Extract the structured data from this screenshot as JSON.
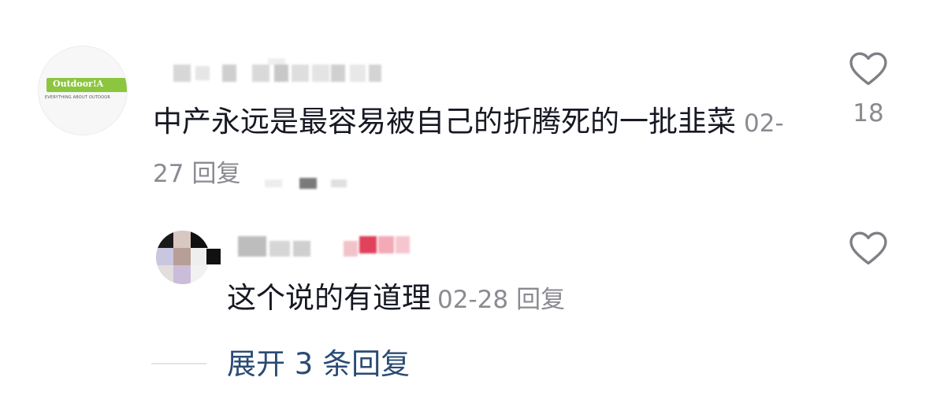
{
  "comment": {
    "avatar": {
      "brand": "Outdoor!A",
      "tagline": "EVERYTHING ABOUT OUTDOOR",
      "accent": "#8cc63f"
    },
    "text": "中产永远是最容易被自己的折腾死的一批韭菜",
    "date": "02-27",
    "reply_label": "回复",
    "likes": "18",
    "like_icon": "heart-outline-icon"
  },
  "reply": {
    "text": "这个说的有道理",
    "date": "02-28",
    "reply_label": "回复",
    "like_icon": "heart-outline-icon"
  },
  "expand": {
    "label": "展开 3 条回复",
    "color": "#2a4b74"
  },
  "colors": {
    "text": "#161823",
    "meta": "#8a8b91"
  }
}
